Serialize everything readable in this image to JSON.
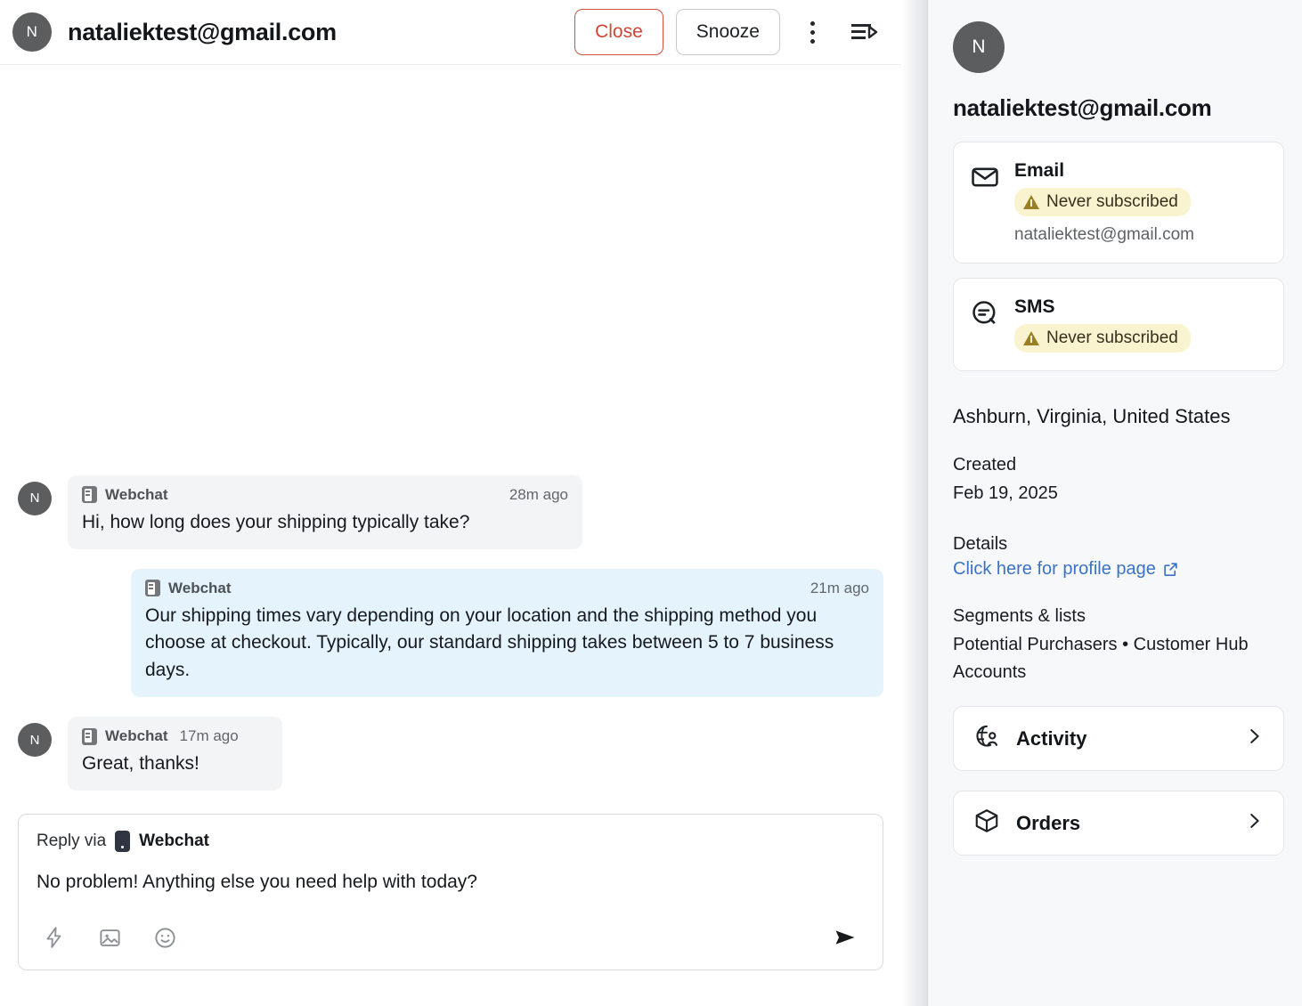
{
  "conversation": {
    "header": {
      "avatar_initial": "N",
      "title": "nataliektest@gmail.com",
      "close_label": "Close",
      "snooze_label": "Snooze",
      "close_color": "#d14534",
      "more_icon": "kebab-menu-icon",
      "panel_icon": "collapse-panel-icon"
    },
    "messages": [
      {
        "direction": "inbound",
        "avatar_initial": "N",
        "channel": "Webchat",
        "time": "28m ago",
        "text": "Hi, how long does your shipping typically take?"
      },
      {
        "direction": "outbound",
        "channel": "Webchat",
        "time": "21m ago",
        "text": "Our shipping times vary depending on your location and the shipping method you choose at checkout. Typically, our standard shipping takes between 5 to 7 business days."
      },
      {
        "direction": "inbound",
        "avatar_initial": "N",
        "channel": "Webchat",
        "time": "17m ago",
        "text": "Great, thanks!"
      }
    ],
    "composer": {
      "reply_via_label": "Reply via",
      "channel": "Webchat",
      "draft_text": "No problem! Anything else you need help with today?",
      "tools": [
        "lightning-bolt-icon",
        "image-icon",
        "emoji-icon"
      ],
      "send_icon": "send-icon"
    }
  },
  "side_panel": {
    "avatar_initial": "N",
    "title": "nataliektest@gmail.com",
    "channels": [
      {
        "icon": "envelope-icon",
        "name": "Email",
        "status": "Never subscribed",
        "status_bg": "#faf3cf",
        "value": "nataliektest@gmail.com"
      },
      {
        "icon": "sms-bubble-icon",
        "name": "SMS",
        "status": "Never subscribed",
        "status_bg": "#faf3cf",
        "value": ""
      }
    ],
    "location": "Ashburn, Virginia, United States",
    "created_label": "Created",
    "created_value": "Feb 19, 2025",
    "details_label": "Details",
    "profile_link": "Click here for profile page",
    "profile_link_color": "#3b73c4",
    "segments_label": "Segments & lists",
    "segments_value": "Potential Purchasers • Customer Hub Accounts",
    "nav": [
      {
        "icon": "activity-globe-person-icon",
        "label": "Activity"
      },
      {
        "icon": "orders-box-icon",
        "label": "Orders"
      }
    ]
  }
}
